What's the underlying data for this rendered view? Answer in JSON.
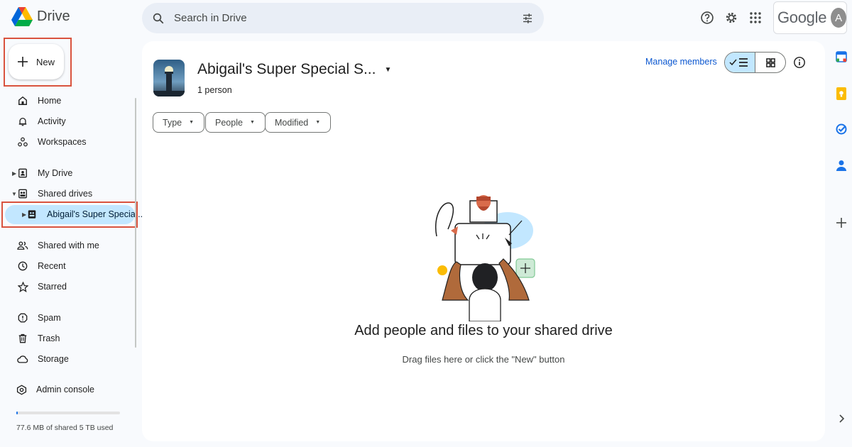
{
  "header": {
    "app_name": "Drive",
    "search_placeholder": "Search in Drive",
    "google_wordmark": "Google",
    "avatar_initial": "A"
  },
  "sidebar": {
    "new_label": "New",
    "items": [
      {
        "label": "Home",
        "icon": "home-icon"
      },
      {
        "label": "Activity",
        "icon": "bell-icon"
      },
      {
        "label": "Workspaces",
        "icon": "workspaces-icon"
      },
      {
        "label": "My Drive",
        "icon": "my-drive-icon"
      },
      {
        "label": "Shared drives",
        "icon": "shared-drives-icon"
      },
      {
        "label": "Abigail's Super Specia...",
        "icon": "shared-drive-icon"
      },
      {
        "label": "Shared with me",
        "icon": "people-icon"
      },
      {
        "label": "Recent",
        "icon": "clock-icon"
      },
      {
        "label": "Starred",
        "icon": "star-icon"
      },
      {
        "label": "Spam",
        "icon": "spam-icon"
      },
      {
        "label": "Trash",
        "icon": "trash-icon"
      },
      {
        "label": "Storage",
        "icon": "cloud-icon"
      },
      {
        "label": "Admin console",
        "icon": "admin-icon"
      }
    ],
    "storage_text": "77.6 MB of shared 5 TB used",
    "storage_fraction": 1.55e-05
  },
  "main": {
    "drive_name": "Abigail's Super Special S...",
    "member_count": "1 person",
    "manage_members": "Manage members",
    "view_mode": "list",
    "filters": [
      "Type",
      "People",
      "Modified"
    ],
    "empty_title": "Add people and files to your shared drive",
    "empty_subtitle": "Drag files here or click the \"New\" button"
  },
  "right_rail": [
    "calendar-icon",
    "keep-icon",
    "tasks-icon",
    "contacts-icon",
    "add-icon",
    "expand-icon"
  ],
  "colors": {
    "accent_blue": "#0b57d0",
    "selected_bg": "#c2e7ff",
    "highlight_red": "#d9533e",
    "page_bg": "#f8fafd"
  }
}
